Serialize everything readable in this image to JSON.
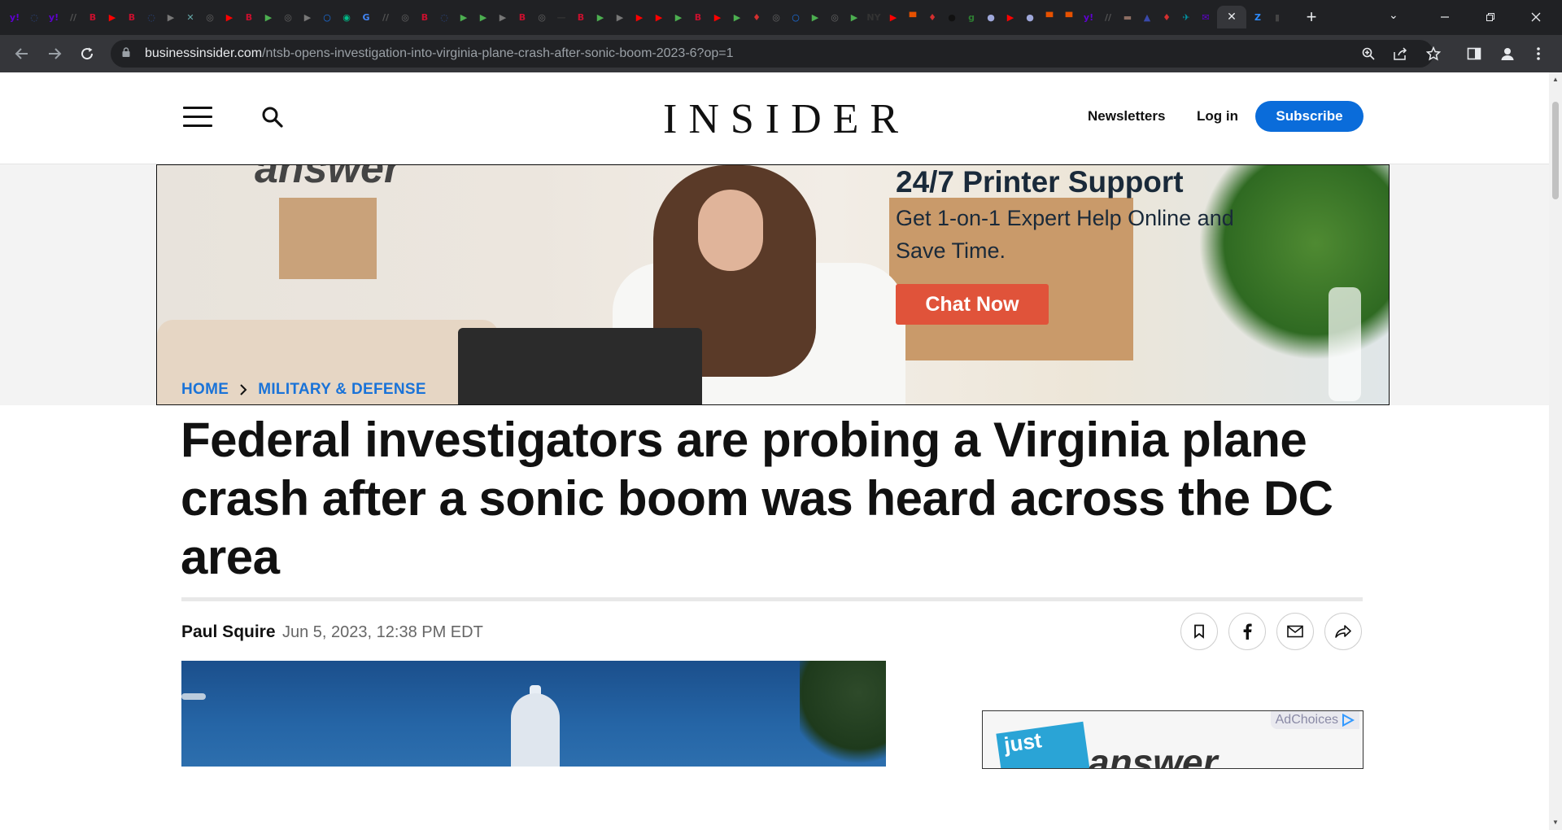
{
  "browser": {
    "url_host": "businessinsider.com",
    "url_path": "/ntsb-opens-investigation-into-virginia-plane-crash-after-sonic-boom-2023-6?op=1",
    "active_tab_close": "✕",
    "new_tab": "+",
    "tab_search": "⌄",
    "tab_icons": [
      {
        "label": "y!",
        "color": "#5f01d1"
      },
      {
        "label": "◌",
        "color": "#2b4a8a"
      },
      {
        "label": "y!",
        "color": "#5f01d1"
      },
      {
        "label": "//",
        "color": "#555"
      },
      {
        "label": "B",
        "color": "#c8102e"
      },
      {
        "label": "▶",
        "color": "#ff0000"
      },
      {
        "label": "B",
        "color": "#c8102e"
      },
      {
        "label": "◌",
        "color": "#2b4a8a"
      },
      {
        "label": "▶",
        "color": "#777"
      },
      {
        "label": "✕",
        "color": "#6aa"
      },
      {
        "label": "◎",
        "color": "#666"
      },
      {
        "label": "▶",
        "color": "#ff0000"
      },
      {
        "label": "B",
        "color": "#c8102e"
      },
      {
        "label": "▶",
        "color": "#4caf50"
      },
      {
        "label": "◎",
        "color": "#666"
      },
      {
        "label": "▶",
        "color": "#777"
      },
      {
        "label": "○",
        "color": "#1a73e8"
      },
      {
        "label": "◉",
        "color": "#0b8"
      },
      {
        "label": "G",
        "color": "#4285f4"
      },
      {
        "label": "//",
        "color": "#555"
      },
      {
        "label": "◎",
        "color": "#666"
      },
      {
        "label": "B",
        "color": "#c8102e"
      },
      {
        "label": "◌",
        "color": "#2b4a8a"
      },
      {
        "label": "▶",
        "color": "#4caf50"
      },
      {
        "label": "▶",
        "color": "#4caf50"
      },
      {
        "label": "▶",
        "color": "#777"
      },
      {
        "label": "B",
        "color": "#c8102e"
      },
      {
        "label": "◎",
        "color": "#666"
      },
      {
        "label": "—",
        "color": "#333"
      },
      {
        "label": "B",
        "color": "#c8102e"
      },
      {
        "label": "▶",
        "color": "#4caf50"
      },
      {
        "label": "▶",
        "color": "#777"
      },
      {
        "label": "▶",
        "color": "#ff0000"
      },
      {
        "label": "▶",
        "color": "#ff0000"
      },
      {
        "label": "▶",
        "color": "#4caf50"
      },
      {
        "label": "B",
        "color": "#c8102e"
      },
      {
        "label": "▶",
        "color": "#ff0000"
      },
      {
        "label": "▶",
        "color": "#4caf50"
      },
      {
        "label": "♦",
        "color": "#d32f2f"
      },
      {
        "label": "◎",
        "color": "#666"
      },
      {
        "label": "○",
        "color": "#1a73e8"
      },
      {
        "label": "▶",
        "color": "#4caf50"
      },
      {
        "label": "◎",
        "color": "#666"
      },
      {
        "label": "▶",
        "color": "#4caf50"
      },
      {
        "label": "NY",
        "color": "#333"
      },
      {
        "label": "▶",
        "color": "#ff0000"
      },
      {
        "label": "▀",
        "color": "#e65100"
      },
      {
        "label": "♦",
        "color": "#d32f2f"
      },
      {
        "label": "●",
        "color": "#111"
      },
      {
        "label": "g",
        "color": "#2e7d32"
      },
      {
        "label": "●",
        "color": "#9fa8da"
      },
      {
        "label": "▶",
        "color": "#ff0000"
      },
      {
        "label": "●",
        "color": "#9fa8da"
      },
      {
        "label": "▀",
        "color": "#e65100"
      },
      {
        "label": "▀",
        "color": "#e65100"
      },
      {
        "label": "y!",
        "color": "#5f01d1"
      },
      {
        "label": "//",
        "color": "#555"
      },
      {
        "label": "▬",
        "color": "#8d6e63"
      },
      {
        "label": "▲",
        "color": "#3949ab"
      },
      {
        "label": "♦",
        "color": "#d32f2f"
      },
      {
        "label": "✈",
        "color": "#0097a7"
      },
      {
        "label": "✉",
        "color": "#5f01d1"
      }
    ],
    "after_active_icons": [
      {
        "label": "Z",
        "color": "#2d8cff"
      },
      {
        "label": "▮",
        "color": "#444"
      }
    ]
  },
  "header": {
    "logo": "INSIDER",
    "newsletters": "Newsletters",
    "login": "Log in",
    "subscribe": "Subscribe"
  },
  "ad": {
    "brand": "answer",
    "headline": "24/7 Printer Support",
    "subline": "Get 1-on-1 Expert Help Online and Save Time.",
    "cta": "Chat Now"
  },
  "article": {
    "breadcrumb_home": "HOME",
    "breadcrumb_section": "MILITARY & DEFENSE",
    "title": "Federal investigators are probing a Virginia plane crash after a sonic boom was heard across the DC area",
    "author": "Paul Squire",
    "date": "Jun 5, 2023, 12:38 PM EDT"
  },
  "side_ad": {
    "adchoices": "AdChoices",
    "brand_tag": "just",
    "brand_word": "answer"
  },
  "colors": {
    "accent": "#0a6cda",
    "breadcrumb": "#1a73d8",
    "ad_cta": "#e0533a"
  }
}
